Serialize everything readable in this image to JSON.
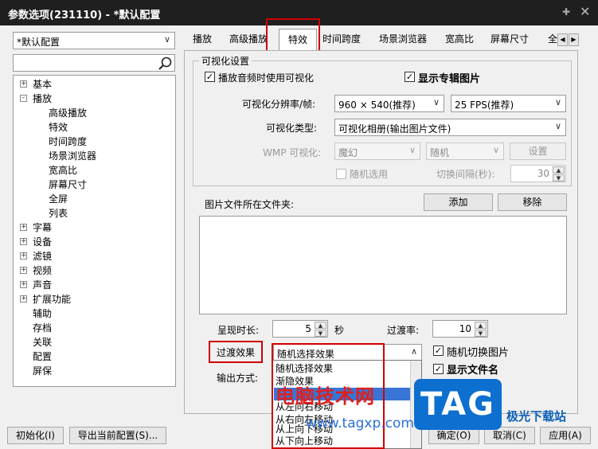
{
  "window": {
    "title": "参数选项(231110) - *默认配置",
    "pin_icon": "pin-icon",
    "close_icon": "close-icon"
  },
  "profile": {
    "selected": "*默认配置"
  },
  "search": {
    "value": ""
  },
  "tree": [
    {
      "label": "基本",
      "level": 0,
      "expander": "+"
    },
    {
      "label": "播放",
      "level": 0,
      "expander": "-"
    },
    {
      "label": "高级播放",
      "level": 1
    },
    {
      "label": "特效",
      "level": 1
    },
    {
      "label": "时间跨度",
      "level": 1
    },
    {
      "label": "场景浏览器",
      "level": 1
    },
    {
      "label": "宽高比",
      "level": 1
    },
    {
      "label": "屏幕尺寸",
      "level": 1
    },
    {
      "label": "全屏",
      "level": 1
    },
    {
      "label": "列表",
      "level": 1
    },
    {
      "label": "字幕",
      "level": 0,
      "expander": "+"
    },
    {
      "label": "设备",
      "level": 0,
      "expander": "+"
    },
    {
      "label": "滤镜",
      "level": 0,
      "expander": "+"
    },
    {
      "label": "视频",
      "level": 0,
      "expander": "+"
    },
    {
      "label": "声音",
      "level": 0,
      "expander": "+"
    },
    {
      "label": "扩展功能",
      "level": 0,
      "expander": "+"
    },
    {
      "label": "辅助",
      "level": 0
    },
    {
      "label": "存档",
      "level": 0
    },
    {
      "label": "关联",
      "level": 0
    },
    {
      "label": "配置",
      "level": 0
    },
    {
      "label": "屏保",
      "level": 0
    }
  ],
  "tabs": [
    "播放",
    "高级播放",
    "特效",
    "时间跨度",
    "场景浏览器",
    "宽高比",
    "屏幕尺寸",
    "全"
  ],
  "tab_selected": "特效",
  "viz": {
    "group_title": "可视化设置",
    "use_viz_label": "播放音频时使用可视化",
    "use_viz_checked": "✓",
    "show_album_label": "显示专辑图片",
    "show_album_checked": "✓",
    "res_label": "可视化分辨率/帧:",
    "res_value": "960 × 540(推荐)",
    "fps_value": "25 FPS(推荐)",
    "type_label": "可视化类型:",
    "type_value": "可视化相册(输出图片文件)",
    "wmp_label": "WMP 可视化:",
    "wmp_value1": "魔幻",
    "wmp_value2": "随机",
    "settings_button": "设置",
    "random_label": "随机选用",
    "interval_label": "切换间隔(秒):",
    "interval_value": "30"
  },
  "folder": {
    "label": "图片文件所在文件夹:",
    "add_button": "添加",
    "remove_button": "移除"
  },
  "timing": {
    "duration_label": "呈现时长:",
    "duration_value": "5",
    "duration_unit": "秒",
    "rate_label": "过渡率:",
    "rate_value": "10"
  },
  "transition": {
    "label": "过渡效果",
    "value": "随机选择效果",
    "random_switch_label": "随机切换图片",
    "random_switch_checked": "✓",
    "show_filename_label": "显示文件名",
    "show_filename_checked": "✓",
    "output_label": "输出方式:"
  },
  "dropdown_items": [
    "随机选择效果",
    "渐隐效果",
    "",
    "从左向右移动",
    "从右向左移动",
    "从上向下移动",
    "从下向上移动"
  ],
  "bottom": {
    "init_button": "初始化(I)",
    "export_button": "导出当前配置(S)...",
    "ok_button": "确定(O)",
    "cancel_button": "取消(C)",
    "apply_button": "应用(A)"
  },
  "watermark": {
    "text": "电脑技术网",
    "url": "www.tagxp.com",
    "logo": "TAG",
    "site": "极光下载站"
  }
}
